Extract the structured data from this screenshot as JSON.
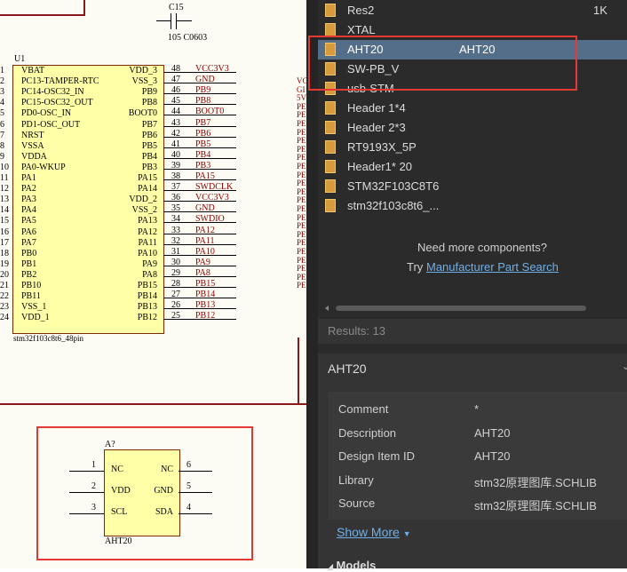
{
  "schematic": {
    "top_component": {
      "ref": "C15",
      "value": "105 C0603"
    },
    "u1": {
      "ref": "U1",
      "name": "stm32f103c8t6_48pin",
      "left_pins": [
        {
          "num": "1",
          "label": "VBAT"
        },
        {
          "num": "2",
          "label": "PC13-TAMPER-RTC"
        },
        {
          "num": "3",
          "label": "PC14-OSC32_IN"
        },
        {
          "num": "4",
          "label": "PC15-OSC32_OUT"
        },
        {
          "num": "5",
          "label": "PD0-OSC_IN"
        },
        {
          "num": "6",
          "label": "PD1-OSC_OUT"
        },
        {
          "num": "7",
          "label": "NRST"
        },
        {
          "num": "8",
          "label": "VSSA"
        },
        {
          "num": "9",
          "label": "VDDA"
        },
        {
          "num": "10",
          "label": "PA0-WKUP"
        },
        {
          "num": "11",
          "label": "PA1"
        },
        {
          "num": "12",
          "label": "PA2"
        },
        {
          "num": "13",
          "label": "PA3"
        },
        {
          "num": "14",
          "label": "PA4"
        },
        {
          "num": "15",
          "label": "PA5"
        },
        {
          "num": "16",
          "label": "PA6"
        },
        {
          "num": "17",
          "label": "PA7"
        },
        {
          "num": "18",
          "label": "PB0"
        },
        {
          "num": "19",
          "label": "PB1"
        },
        {
          "num": "20",
          "label": "PB2"
        },
        {
          "num": "21",
          "label": "PB10"
        },
        {
          "num": "22",
          "label": "PB11"
        },
        {
          "num": "23",
          "label": "VSS_1"
        },
        {
          "num": "24",
          "label": "VDD_1"
        }
      ],
      "right_pins": [
        {
          "num": "48",
          "label": "VDD_3",
          "net": "VCC3V3"
        },
        {
          "num": "47",
          "label": "VSS_3",
          "net": "GND"
        },
        {
          "num": "46",
          "label": "PB9",
          "net": "PB9"
        },
        {
          "num": "45",
          "label": "PB8",
          "net": "PB8"
        },
        {
          "num": "44",
          "label": "BOOT0",
          "net": "BOOT0"
        },
        {
          "num": "43",
          "label": "PB7",
          "net": "PB7"
        },
        {
          "num": "42",
          "label": "PB6",
          "net": "PB6"
        },
        {
          "num": "41",
          "label": "PB5",
          "net": "PB5"
        },
        {
          "num": "40",
          "label": "PB4",
          "net": "PB4"
        },
        {
          "num": "39",
          "label": "PB3",
          "net": "PB3"
        },
        {
          "num": "38",
          "label": "PA15",
          "net": "PA15"
        },
        {
          "num": "37",
          "label": "PA14",
          "net": "SWDCLK"
        },
        {
          "num": "36",
          "label": "VDD_2",
          "net": "VCC3V3"
        },
        {
          "num": "35",
          "label": "VSS_2",
          "net": "GND"
        },
        {
          "num": "34",
          "label": "PA13",
          "net": "SWDIO"
        },
        {
          "num": "33",
          "label": "PA12",
          "net": "PA12"
        },
        {
          "num": "32",
          "label": "PA11",
          "net": "PA11"
        },
        {
          "num": "31",
          "label": "PA10",
          "net": "PA10"
        },
        {
          "num": "30",
          "label": "PA9",
          "net": "PA9"
        },
        {
          "num": "29",
          "label": "PA8",
          "net": "PA8"
        },
        {
          "num": "28",
          "label": "PB15",
          "net": "PB15"
        },
        {
          "num": "27",
          "label": "PB14",
          "net": "PB14"
        },
        {
          "num": "26",
          "label": "PB13",
          "net": "PB13"
        },
        {
          "num": "25",
          "label": "PB12",
          "net": "PB12"
        }
      ],
      "far_right_nets": [
        "VC",
        "GI",
        "5V",
        "PE",
        "PE",
        "PE",
        "PE",
        "PE",
        "PE",
        "PE",
        "PE",
        "PE",
        "PE",
        "PE",
        "PE",
        "PE",
        "PE",
        "PE",
        "PE",
        "PE",
        "PE",
        "PE",
        "PE",
        "PE",
        "PE"
      ]
    },
    "aht20_symbol": {
      "ref": "A?",
      "name": "AHT20",
      "left_pins": [
        {
          "num": "1",
          "label": "NC"
        },
        {
          "num": "2",
          "label": "VDD"
        },
        {
          "num": "3",
          "label": "SCL"
        }
      ],
      "right_pins": [
        {
          "num": "6",
          "label": "NC"
        },
        {
          "num": "5",
          "label": "GND"
        },
        {
          "num": "4",
          "label": "SDA"
        }
      ]
    }
  },
  "components_list": [
    {
      "name": "Res2",
      "extra": "1K",
      "selected": false
    },
    {
      "name": "XTAL",
      "extra": "",
      "selected": false
    },
    {
      "name": "AHT20",
      "extra": "AHT20",
      "selected": true
    },
    {
      "name": "SW-PB_V",
      "extra": "",
      "selected": false
    },
    {
      "name": "usb-STM",
      "extra": "",
      "selected": false
    },
    {
      "name": "Header 1*4",
      "extra": "",
      "selected": false
    },
    {
      "name": "Header 2*3",
      "extra": "",
      "selected": false
    },
    {
      "name": "RT9193X_5P",
      "extra": "",
      "selected": false
    },
    {
      "name": "Header1* 20",
      "extra": "",
      "selected": false
    },
    {
      "name": "STM32F103C8T6",
      "extra": "",
      "selected": false
    },
    {
      "name": "stm32f103c8t6_...",
      "extra": "",
      "selected": false
    }
  ],
  "more_components": {
    "question": "Need more components?",
    "try_text": "Try",
    "link": "Manufacturer Part Search"
  },
  "results": "Results: 13",
  "details": {
    "title": "AHT20",
    "rows": [
      {
        "key": "Comment",
        "value": "*"
      },
      {
        "key": "Description",
        "value": "AHT20"
      },
      {
        "key": "Design Item ID",
        "value": "AHT20"
      },
      {
        "key": "Library",
        "value": "stm32原理图库.SCHLIB"
      },
      {
        "key": "Source",
        "value": "stm32原理图库.SCHLIB"
      }
    ],
    "show_more": "Show More",
    "models_label": "Models"
  },
  "colors": {
    "selection": "#546e8a",
    "highlight_box": "#e53935",
    "link": "#6fb0e8"
  }
}
